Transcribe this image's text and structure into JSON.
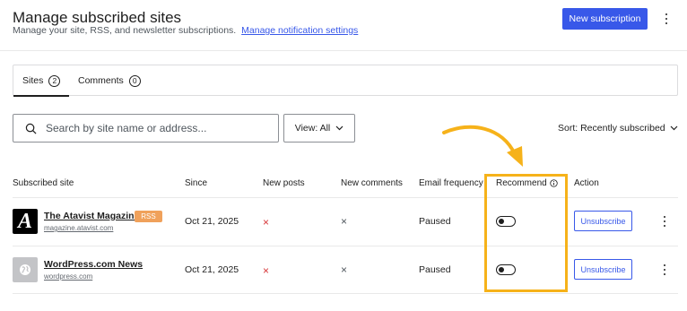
{
  "header": {
    "title": "Manage subscribed sites",
    "subtitle": "Manage your site, RSS, and newsletter subscriptions.",
    "settings_link": "Manage notification settings",
    "new_button": "New subscription",
    "more_icon": "kebab-icon"
  },
  "tabs": [
    {
      "label": "Sites",
      "count": "2",
      "active": true
    },
    {
      "label": "Comments",
      "count": "0",
      "active": false
    }
  ],
  "toolbar": {
    "search_placeholder": "Search by site name or address...",
    "search_icon": "search-icon",
    "view_label": "View: All",
    "sort_label": "Sort: Recently subscribed"
  },
  "table": {
    "columns": [
      "Subscribed site",
      "Since",
      "New posts",
      "New comments",
      "Email frequency",
      "Recommend",
      "Action"
    ],
    "rows": [
      {
        "name": "The Atavist Magazine",
        "logo_letter": "A",
        "badge": "RSS",
        "url": "magazine.atavist.com",
        "since": "Oct 21, 2025",
        "new_posts": "×",
        "new_comments": "×",
        "email_frequency": "Paused",
        "recommend": false,
        "action": "Unsubscribe"
      },
      {
        "name": "WordPress.com News",
        "logo_letter": "",
        "badge": "",
        "url": "wordpress.com",
        "since": "Oct 21, 2025",
        "new_posts": "×",
        "new_comments": "×",
        "email_frequency": "Paused",
        "recommend": false,
        "action": "Unsubscribe"
      }
    ]
  },
  "colors": {
    "accent": "#3858e9",
    "rss_badge": "#f0a15b",
    "red_x": "#d63638",
    "highlight": "#f6b21a"
  }
}
